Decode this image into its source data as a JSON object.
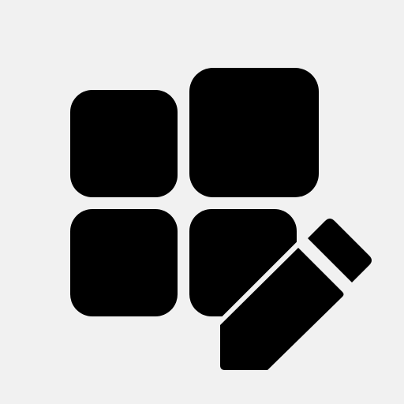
{
  "icon": {
    "name": "edit-grid-icon",
    "color": "#000000",
    "background": "#f1f1f1"
  }
}
